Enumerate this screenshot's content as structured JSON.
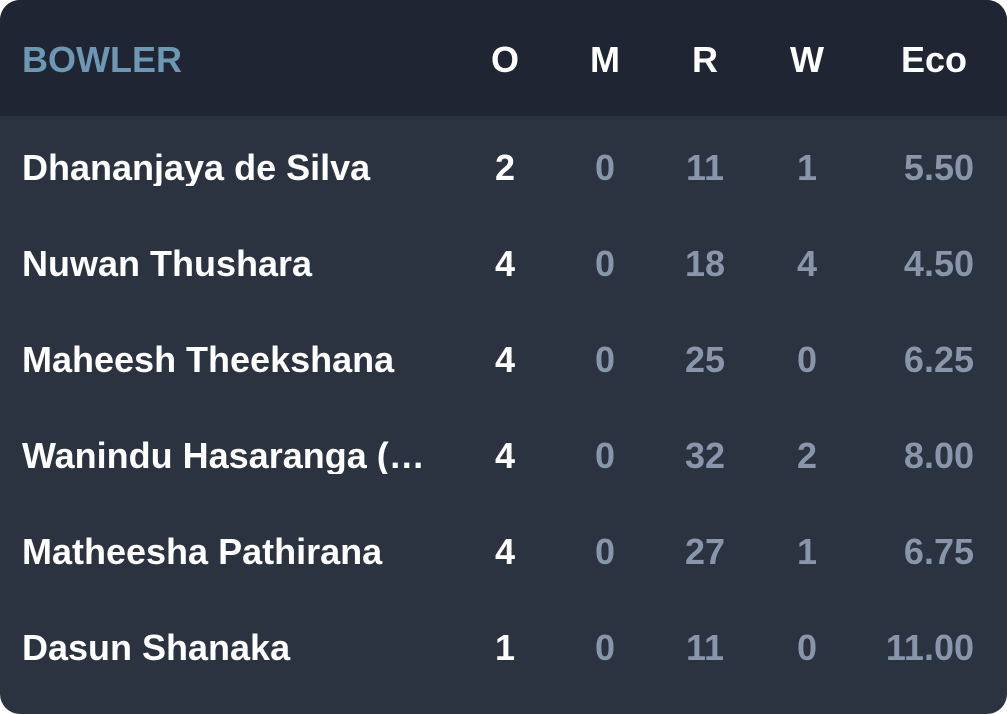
{
  "header": {
    "bowler": "BOWLER",
    "overs": "O",
    "maidens": "M",
    "runs": "R",
    "wickets": "W",
    "economy": "Eco"
  },
  "rows": [
    {
      "name": "Dhananjaya de Silva",
      "o": "2",
      "m": "0",
      "r": "11",
      "w": "1",
      "eco": "5.50"
    },
    {
      "name": "Nuwan Thushara",
      "o": "4",
      "m": "0",
      "r": "18",
      "w": "4",
      "eco": "4.50"
    },
    {
      "name": "Maheesh Theekshana",
      "o": "4",
      "m": "0",
      "r": "25",
      "w": "0",
      "eco": "6.25"
    },
    {
      "name": "Wanindu Hasaranga (…",
      "o": "4",
      "m": "0",
      "r": "32",
      "w": "2",
      "eco": "8.00"
    },
    {
      "name": "Matheesha Pathirana",
      "o": "4",
      "m": "0",
      "r": "27",
      "w": "1",
      "eco": "6.75"
    },
    {
      "name": "Dasun Shanaka",
      "o": "1",
      "m": "0",
      "r": "11",
      "w": "0",
      "eco": "11.00"
    }
  ]
}
